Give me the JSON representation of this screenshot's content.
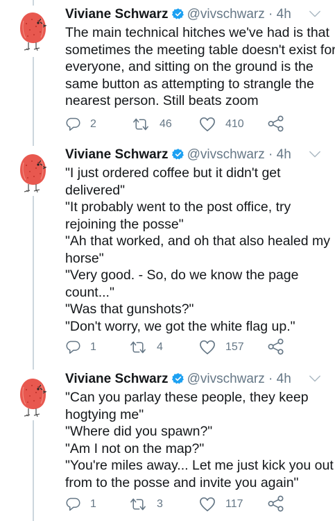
{
  "tweets": [
    {
      "name": "Viviane Schwarz",
      "handle": "@vivschwarz",
      "time": "4h",
      "lines": [
        "The main technical hitches we've had is that",
        "sometimes the meeting table doesn't exist for",
        "everyone, and sitting on the ground is the",
        "same button as attempting to strangle the",
        "nearest person. Still beats zoom"
      ],
      "replies": "2",
      "retweets": "46",
      "likes": "410"
    },
    {
      "name": "Viviane Schwarz",
      "handle": "@vivschwarz",
      "time": "4h",
      "lines": [
        "\"I just ordered coffee but it didn't get",
        "delivered\"",
        "\"It probably went to the post office, try",
        "rejoining the posse\"",
        "\"Ah that worked, and oh that also healed my",
        "horse\"",
        "\"Very good. - So, do we know the page",
        "count...\"",
        "\"Was that gunshots?\"",
        "\"Don't worry, we got the white flag up.\""
      ],
      "replies": "1",
      "retweets": "4",
      "likes": "157"
    },
    {
      "name": "Viviane Schwarz",
      "handle": "@vivschwarz",
      "time": "4h",
      "lines": [
        "\"Can you parlay these people, they keep",
        "hogtying me\"",
        "\"Where did you spawn?\"",
        "\"Am I not on the map?\"",
        "\"You're miles away... Let me just kick you out",
        "from to the posse and invite you again\""
      ],
      "replies": "1",
      "retweets": "3",
      "likes": "117"
    }
  ],
  "colors": {
    "text": "#14171a",
    "secondary": "#657786",
    "verified": "#1da1f2",
    "thread_line": "#ccd6dd",
    "avatar": "#e8584f"
  },
  "icons": [
    "verified-badge-icon",
    "chevron-down-icon",
    "reply-icon",
    "retweet-icon",
    "like-icon",
    "share-icon",
    "avatar-creature"
  ]
}
